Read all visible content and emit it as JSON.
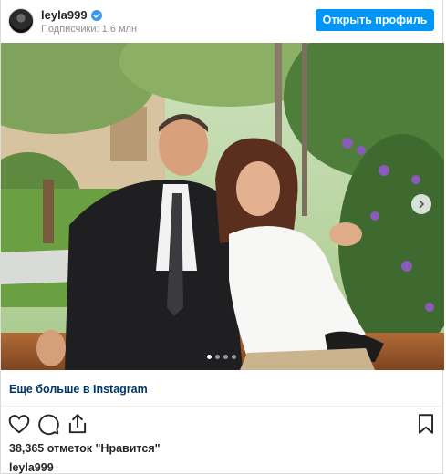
{
  "header": {
    "username": "leyla999",
    "followers": "Подписчики: 1.6 млн",
    "open_profile_label": "Открыть профиль",
    "verified_icon": "verified-badge-icon"
  },
  "photo": {
    "description_icon": "photo",
    "dots_count": 4,
    "active_dot": 1,
    "next_icon": "chevron-right-icon"
  },
  "more": {
    "label": "Еще больше в Instagram"
  },
  "actions": {
    "like_icon": "heart-icon",
    "comment_icon": "comment-icon",
    "share_icon": "share-icon",
    "save_icon": "bookmark-icon"
  },
  "likes_text": "38,365 отметок \"Нравится\"",
  "caption_user": "leyla999",
  "colors": {
    "accent": "#0095f6",
    "link": "#00376b",
    "text": "#262626",
    "muted": "#8e8e8e"
  }
}
